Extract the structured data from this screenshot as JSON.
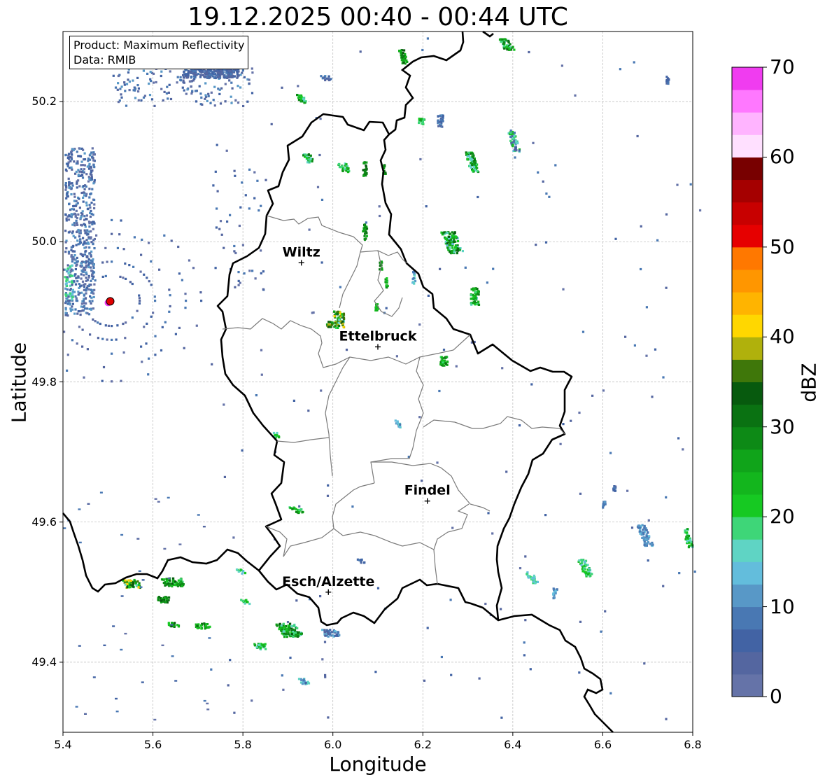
{
  "title": "19.12.2025 00:40 - 00:44 UTC",
  "info": {
    "product": "Product: Maximum Reflectivity",
    "data": "Data: RMIB"
  },
  "axes": {
    "xlabel": "Longitude",
    "ylabel": "Latitude",
    "xlim": [
      5.4,
      6.8
    ],
    "ylim": [
      49.3,
      50.3
    ],
    "xticks": [
      "5.4",
      "5.6",
      "5.8",
      "6.0",
      "6.2",
      "6.4",
      "6.6",
      "6.8"
    ],
    "yticks": [
      "49.4",
      "49.6",
      "49.8",
      "50.0",
      "50.2"
    ],
    "grid": true
  },
  "colorbar": {
    "label": "dBZ",
    "ticks": [
      "0",
      "10",
      "20",
      "30",
      "40",
      "50",
      "60",
      "70"
    ],
    "colors": [
      "#6573a8",
      "#5466a0",
      "#4263a4",
      "#4978b3",
      "#5898c7",
      "#63bddc",
      "#5fd4c4",
      "#3ed678",
      "#16c922",
      "#13b61d",
      "#10a41a",
      "#0d8a16",
      "#0a7212",
      "#075a0e",
      "#3f770a",
      "#b0b10c",
      "#ffd700",
      "#ffb400",
      "#ff9600",
      "#ff7800",
      "#e60000",
      "#c80000",
      "#a50000",
      "#780000",
      "#ffe0ff",
      "#ffb4ff",
      "#ff78ff",
      "#f03cf0"
    ]
  },
  "places": [
    {
      "name": "Wiltz",
      "lon": 5.93,
      "lat": 49.97
    },
    {
      "name": "Ettelbruck",
      "lon": 6.1,
      "lat": 49.85
    },
    {
      "name": "Findel",
      "lon": 6.21,
      "lat": 49.63
    },
    {
      "name": "Esch/Alzette",
      "lon": 5.99,
      "lat": 49.5
    }
  ],
  "radar_site": {
    "lon": 5.505,
    "lat": 49.915,
    "color": "#e00000"
  }
}
